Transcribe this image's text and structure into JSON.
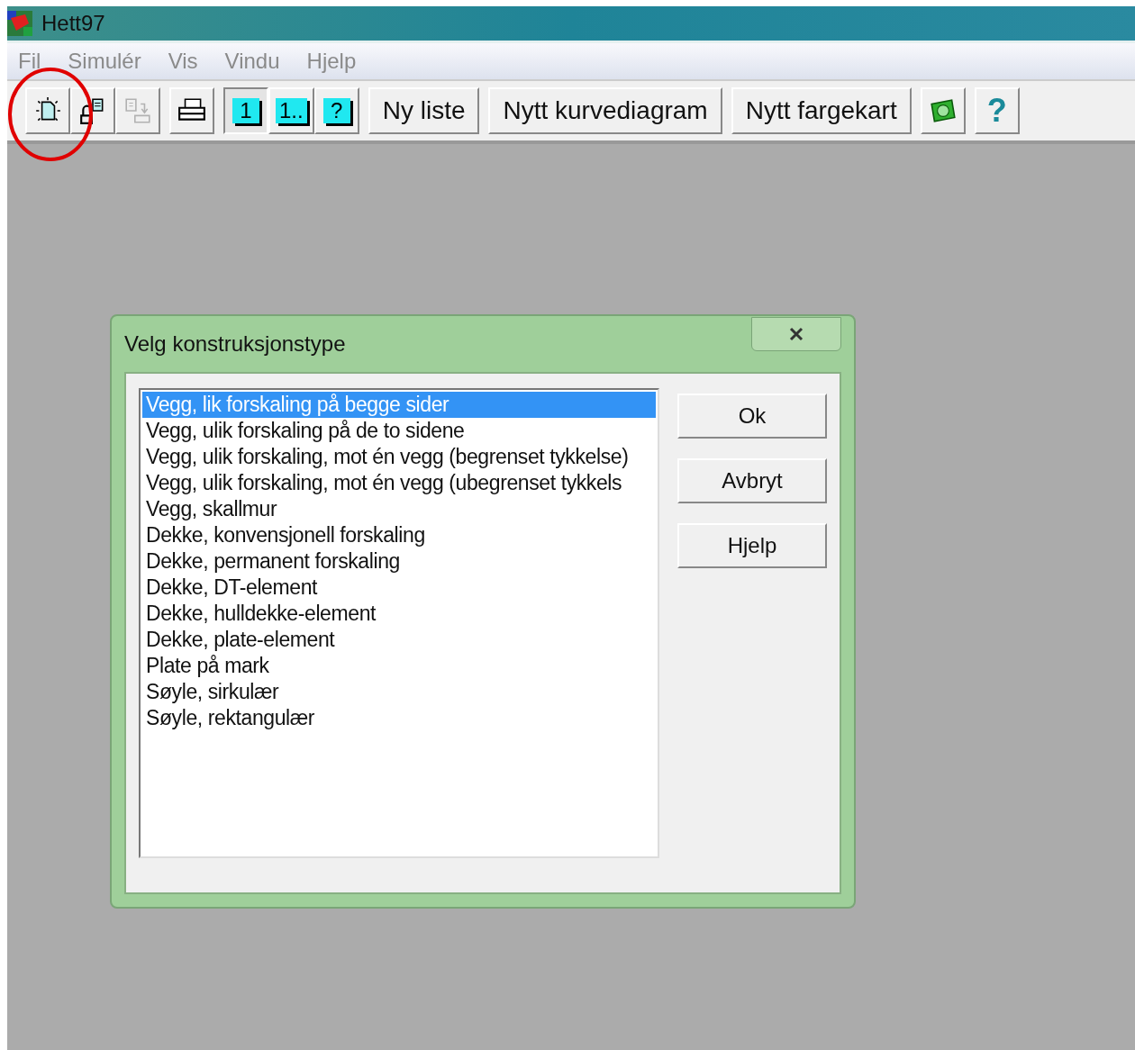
{
  "window": {
    "title": "Hett97"
  },
  "menu": [
    "Fil",
    "Simulér",
    "Vis",
    "Vindu",
    "Hjelp"
  ],
  "toolbar": {
    "file_tools": [
      {
        "disabled": false
      },
      {
        "disabled": false
      },
      {
        "disabled": true
      }
    ],
    "view_buttons": [
      {
        "label": "1",
        "pressed": true
      },
      {
        "label": "1..",
        "pressed": false
      },
      {
        "label": "?",
        "pressed": false
      }
    ],
    "text_buttons": [
      "Ny liste",
      "Nytt kurvediagram",
      "Nytt fargekart"
    ],
    "help_button": "?"
  },
  "dialog": {
    "title": "Velg konstruksjonstype",
    "items": [
      {
        "label": "Vegg, lik forskaling på begge sider",
        "selected": true
      },
      {
        "label": "Vegg, ulik forskaling på de to sidene",
        "selected": false
      },
      {
        "label": "Vegg, ulik forskaling, mot én vegg (begrenset tykkelse)",
        "selected": false
      },
      {
        "label": "Vegg, ulik forskaling, mot én vegg (ubegrenset tykkels",
        "selected": false
      },
      {
        "label": "Vegg, skallmur",
        "selected": false
      },
      {
        "label": "Dekke, konvensjonell forskaling",
        "selected": false
      },
      {
        "label": "Dekke, permanent forskaling",
        "selected": false
      },
      {
        "label": "Dekke, DT-element",
        "selected": false
      },
      {
        "label": "Dekke, hulldekke-element",
        "selected": false
      },
      {
        "label": "Dekke, plate-element",
        "selected": false
      },
      {
        "label": "Plate på mark",
        "selected": false
      },
      {
        "label": "Søyle, sirkulær",
        "selected": false
      },
      {
        "label": "Søyle, rektangulær",
        "selected": false
      }
    ],
    "buttons": [
      "Ok",
      "Avbryt",
      "Hjelp"
    ]
  }
}
